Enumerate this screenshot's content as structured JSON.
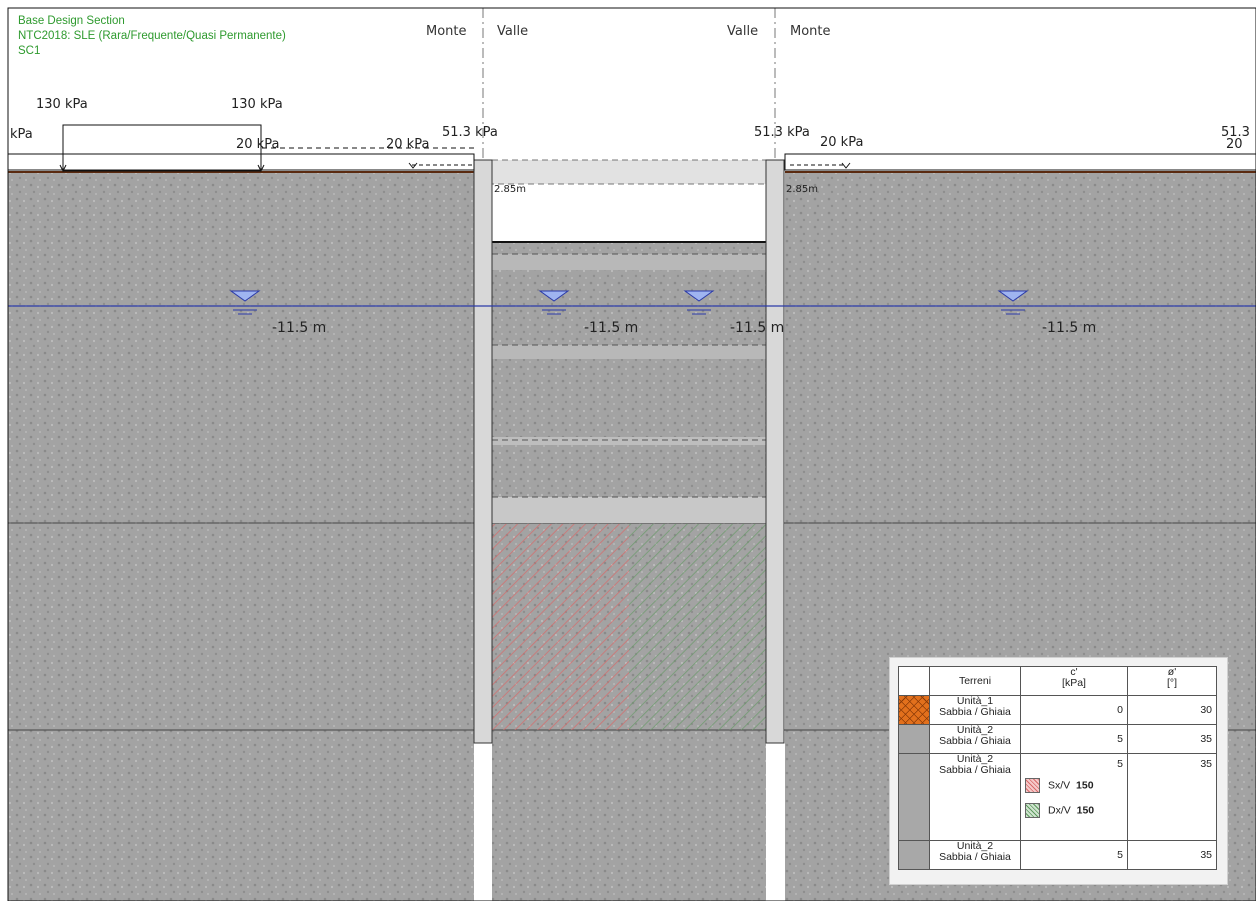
{
  "header": {
    "line1": "Base Design Section",
    "line2": "NTC2018: SLE (Rara/Frequente/Quasi Permanente)",
    "line3": "SC1"
  },
  "sides": {
    "left_monte": "Monte",
    "left_valle": "Valle",
    "right_valle": "Valle",
    "right_monte": "Monte"
  },
  "loads": {
    "edge_left_kpa": "kPa",
    "strip_left": "130 kPa",
    "strip_right": "130 kPa",
    "dist_a": "20 kPa",
    "dist_b": "20 kPa",
    "pt_left": "51.3 kPa",
    "pt_right": "51.3 kPa",
    "dist_right": "20 kPa",
    "edge_right": "51.3",
    "edge_right2": "20"
  },
  "depths": {
    "left_wall_top": "2.85m",
    "right_wall_top": "2.85m"
  },
  "water": {
    "label_1": "-11.5 m",
    "label_2": "-11.5 m",
    "label_3": "-11.5 m",
    "label_4": "-11.5 m"
  },
  "legend": {
    "col_terreni": "Terreni",
    "col_c": "c'",
    "col_c_unit": "[kPa]",
    "col_phi": "ø'",
    "col_phi_unit": "[°]",
    "rows": [
      {
        "name": "Unità_1",
        "type": "Sabbia / Ghiaia",
        "c": "0",
        "phi": "30",
        "color": "#e2701c"
      },
      {
        "name": "Unità_2",
        "type": "Sabbia / Ghiaia",
        "c": "5",
        "phi": "35",
        "color": "#a8a8a8"
      },
      {
        "name": "Unità_2",
        "type": "Sabbia / Ghiaia",
        "c": "5",
        "phi": "35",
        "color": "#a8a8a8"
      },
      {
        "name": "Unità_2",
        "type": "Sabbia / Ghiaia",
        "c": "5",
        "phi": "35",
        "color": "#a8a8a8"
      }
    ],
    "sx_label": "Sx/V",
    "sx_value": "150",
    "dx_label": "Dx/V",
    "dx_value": "150",
    "sx_color": "#e06a6a",
    "dx_color": "#5c9a5c"
  },
  "colors": {
    "soil": "#a0a0a0",
    "water_line": "#2b3aa8",
    "header_text": "#2e9a2e"
  }
}
